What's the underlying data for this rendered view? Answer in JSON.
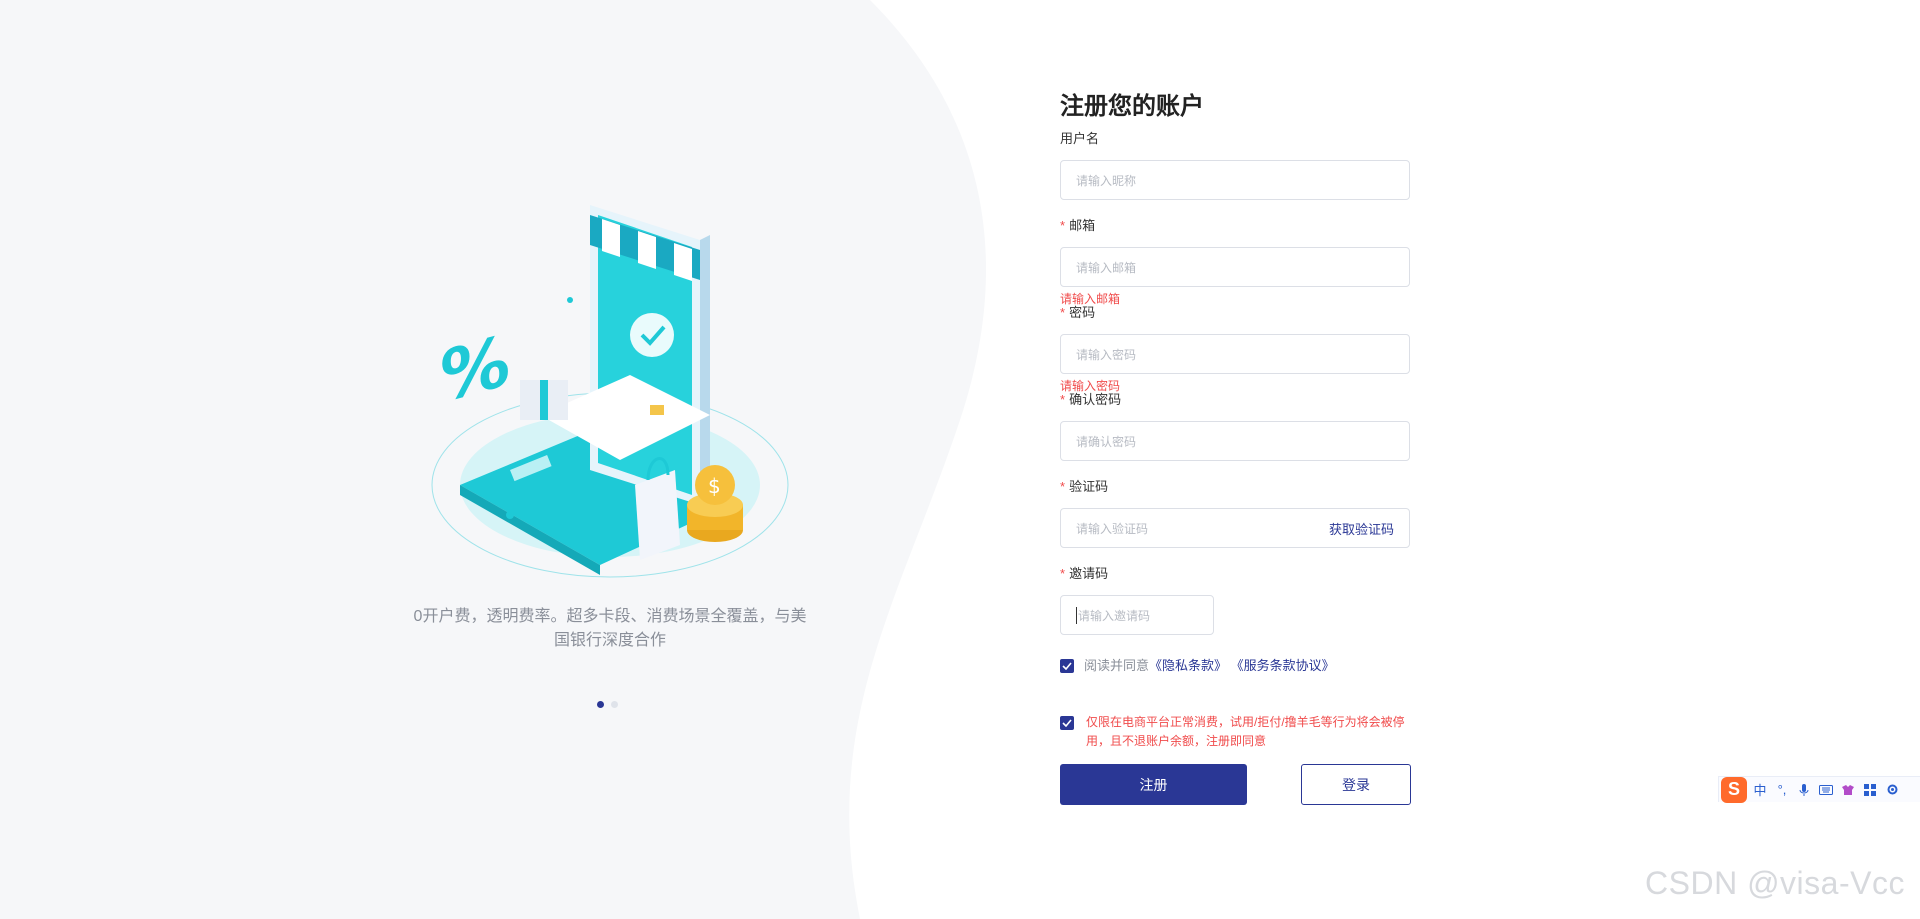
{
  "hero": {
    "slogan_line1": "0开户费，透明费率。超多卡段、消费场景全覆盖，与美",
    "slogan_line2": "国银行深度合作",
    "carousel_active_index": 0,
    "carousel_count": 2
  },
  "form": {
    "title": "注册您的账户",
    "fields": {
      "username": {
        "label": "用户名",
        "placeholder": "请输入昵称",
        "required": false
      },
      "email": {
        "label": "邮箱",
        "placeholder": "请输入邮箱",
        "required": true,
        "error": "请输入邮箱"
      },
      "password": {
        "label": "密码",
        "placeholder": "请输入密码",
        "required": true,
        "error": "请输入密码"
      },
      "confirm": {
        "label": "确认密码",
        "placeholder": "请确认密码",
        "required": true
      },
      "captcha": {
        "label": "验证码",
        "placeholder": "请输入验证码",
        "required": true,
        "action": "获取验证码"
      },
      "invite": {
        "label": "邀请码",
        "placeholder": "请输入邀请码",
        "required": true
      }
    },
    "required_mark": "*",
    "agreement": {
      "checked": true,
      "prefix": "阅读并同意",
      "privacy": "《隐私条款》",
      "service": "《服务条款协议》"
    },
    "notice": {
      "checked": true,
      "text": "仅限在电商平台正常消费，试用/拒付/撸羊毛等行为将会被停用，且不退账户余额，注册即同意"
    },
    "buttons": {
      "register": "注册",
      "login": "登录"
    }
  },
  "ime_toolbar": {
    "logo": "S",
    "items": [
      "中",
      "°,",
      "mic-icon",
      "keyboard-icon",
      "shirt-icon",
      "grid-icon",
      "settings-icon"
    ]
  },
  "watermark": "CSDN @visa-Vcc",
  "colors": {
    "primary": "#2a3795",
    "error": "#f04b4b",
    "teal": "#1ec9d6"
  }
}
